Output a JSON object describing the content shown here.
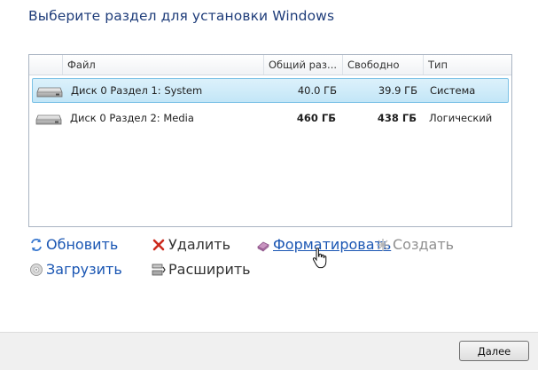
{
  "window": {
    "title": "Выберите раздел для установки Windows"
  },
  "table": {
    "columns": [
      "Файл",
      "Общий раз...",
      "Свободно",
      "Тип"
    ],
    "rows": [
      {
        "name": "Диск 0 Раздел 1: System",
        "total": "40.0 ГБ",
        "free": "39.9 ГБ",
        "type": "Система",
        "selected": true,
        "icon": "hard-drive-icon"
      },
      {
        "name": "Диск 0 Раздел 2: Media",
        "total": "460 ГБ",
        "free": "438 ГБ",
        "type": "Логический",
        "selected": false,
        "icon": "hard-drive-icon"
      }
    ]
  },
  "actions": {
    "refresh": {
      "label": "Обновить",
      "icon": "refresh-icon"
    },
    "delete": {
      "label": "Удалить",
      "icon": "delete-x-icon"
    },
    "format": {
      "label": "Форматировать",
      "icon": "eraser-icon"
    },
    "create": {
      "label": "Создать",
      "icon": "sparkle-icon"
    },
    "load": {
      "label": "Загрузить",
      "icon": "disc-icon"
    },
    "extend": {
      "label": "Расширить",
      "icon": "extend-disk-icon"
    }
  },
  "footer": {
    "next_label": "Далее"
  },
  "colors": {
    "title": "#1f3d7a",
    "link": "#1a56b3",
    "selection": "#c3e6f7",
    "selection_border": "#7dc2e6"
  }
}
